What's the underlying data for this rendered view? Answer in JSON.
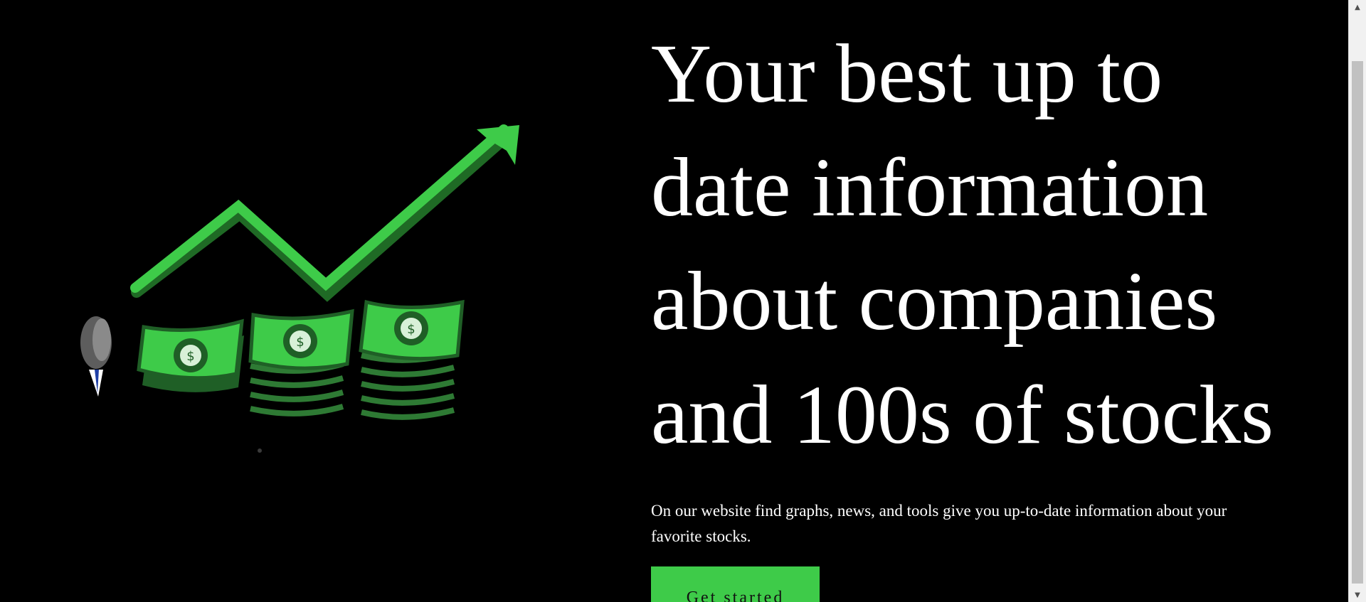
{
  "hero": {
    "headline_lines": [
      "Your best up to",
      "date information",
      "about companies",
      "and 100s of stocks"
    ],
    "subtext": "On our website find graphs, news, and tools give you up-to-date information about your favorite stocks.",
    "cta_label": "Get started"
  },
  "illustration": {
    "description_icon": "stock-growth-money-illustration"
  },
  "colors": {
    "background": "#000000",
    "accent_green": "#3ecb49",
    "text": "#ffffff"
  },
  "scrollbar": {
    "up_arrow": "▲",
    "down_arrow": "▼"
  }
}
